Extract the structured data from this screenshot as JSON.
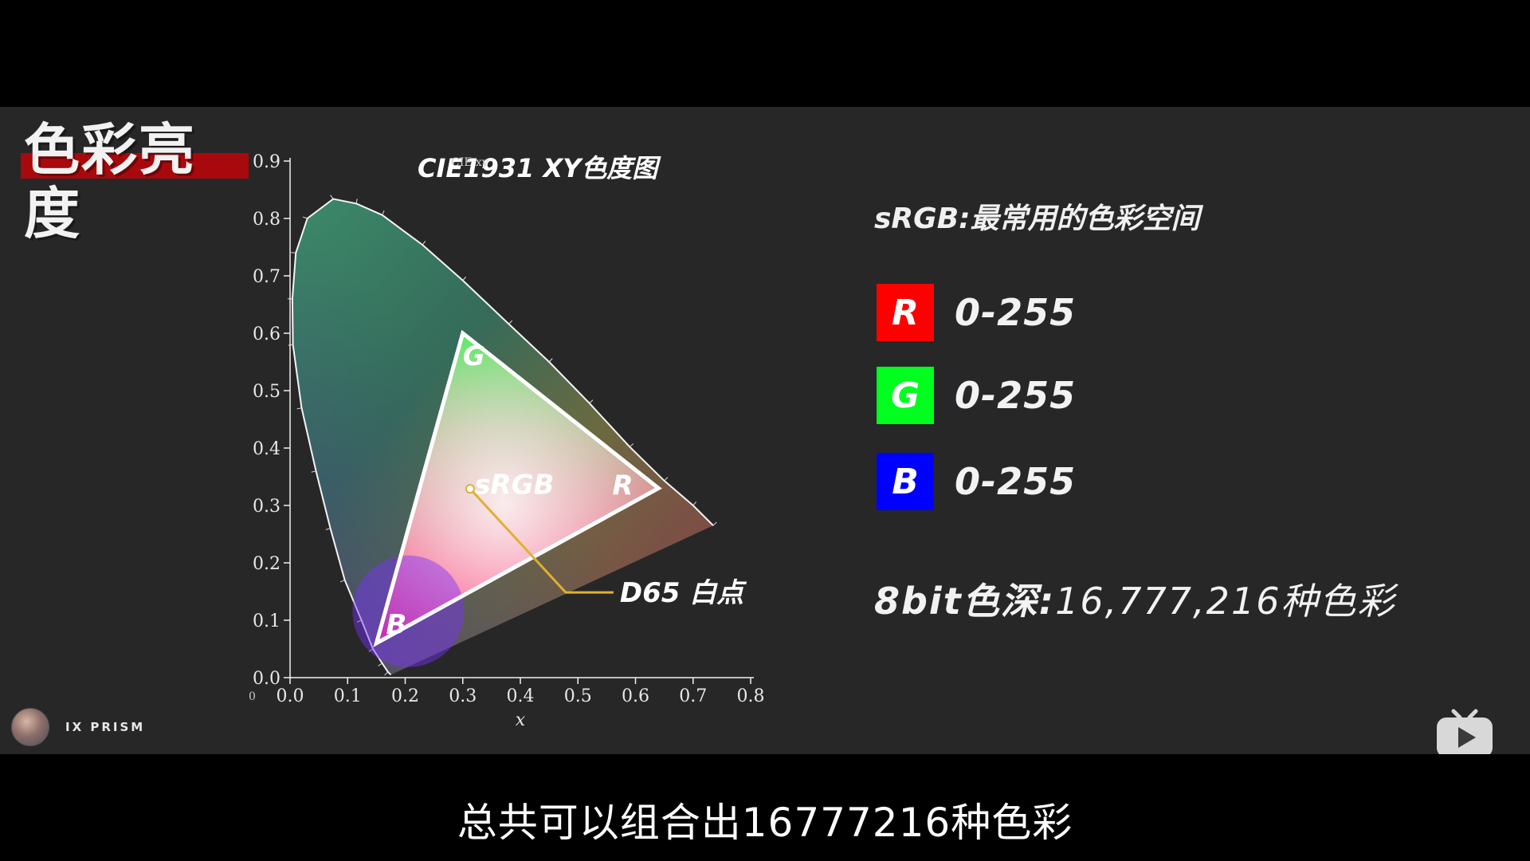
{
  "slide": {
    "title": "色彩亮度"
  },
  "chart_data": {
    "type": "scatter",
    "title": "CIE1931 XY色度图",
    "inset_label": "CIE xy",
    "xlabel": "x",
    "ylabel": "",
    "xlim": [
      0.0,
      0.8
    ],
    "ylim": [
      0.0,
      0.9
    ],
    "x_ticks": [
      "0.0",
      "0.1",
      "0.2",
      "0.3",
      "0.4",
      "0.5",
      "0.6",
      "0.7",
      "0.8"
    ],
    "y_ticks": [
      "0.0",
      "0.1",
      "0.2",
      "0.3",
      "0.4",
      "0.5",
      "0.6",
      "0.7",
      "0.8",
      "0.9"
    ],
    "origin_label": "0",
    "grid": false,
    "spectral_locus": [
      [
        0.175,
        0.005
      ],
      [
        0.17,
        0.01
      ],
      [
        0.16,
        0.025
      ],
      [
        0.144,
        0.05
      ],
      [
        0.124,
        0.1
      ],
      [
        0.095,
        0.17
      ],
      [
        0.07,
        0.26
      ],
      [
        0.045,
        0.36
      ],
      [
        0.02,
        0.47
      ],
      [
        0.005,
        0.58
      ],
      [
        0.004,
        0.66
      ],
      [
        0.01,
        0.74
      ],
      [
        0.03,
        0.8
      ],
      [
        0.075,
        0.834
      ],
      [
        0.115,
        0.826
      ],
      [
        0.16,
        0.806
      ],
      [
        0.23,
        0.754
      ],
      [
        0.3,
        0.692
      ],
      [
        0.38,
        0.616
      ],
      [
        0.45,
        0.55
      ],
      [
        0.52,
        0.478
      ],
      [
        0.59,
        0.402
      ],
      [
        0.65,
        0.343
      ],
      [
        0.7,
        0.3
      ],
      [
        0.735,
        0.265
      ]
    ],
    "series": [
      {
        "name": "sRGB",
        "vertices": [
          {
            "label": "R",
            "x": 0.64,
            "y": 0.33
          },
          {
            "label": "G",
            "x": 0.3,
            "y": 0.6
          },
          {
            "label": "B",
            "x": 0.15,
            "y": 0.06
          }
        ]
      }
    ],
    "white_point": {
      "label": "D65 白点",
      "x": 0.3127,
      "y": 0.329
    }
  },
  "color_space": {
    "heading": "sRGB:最常用的色彩空间",
    "channels": [
      {
        "letter": "R",
        "range": "0-255",
        "color": "#ff0000"
      },
      {
        "letter": "G",
        "range": "0-255",
        "color": "#00ff1e"
      },
      {
        "letter": "B",
        "range": "0-255",
        "color": "#0000ff"
      }
    ],
    "depth_label": "8bit色深:",
    "depth_value": "16,777,216种色彩"
  },
  "watermark": {
    "channel_name": "IX PRISM",
    "avatar_icon": "avatar",
    "platform_icon": "tv-icon"
  },
  "caption": {
    "text": "总共可以组合出16777216种色彩"
  }
}
